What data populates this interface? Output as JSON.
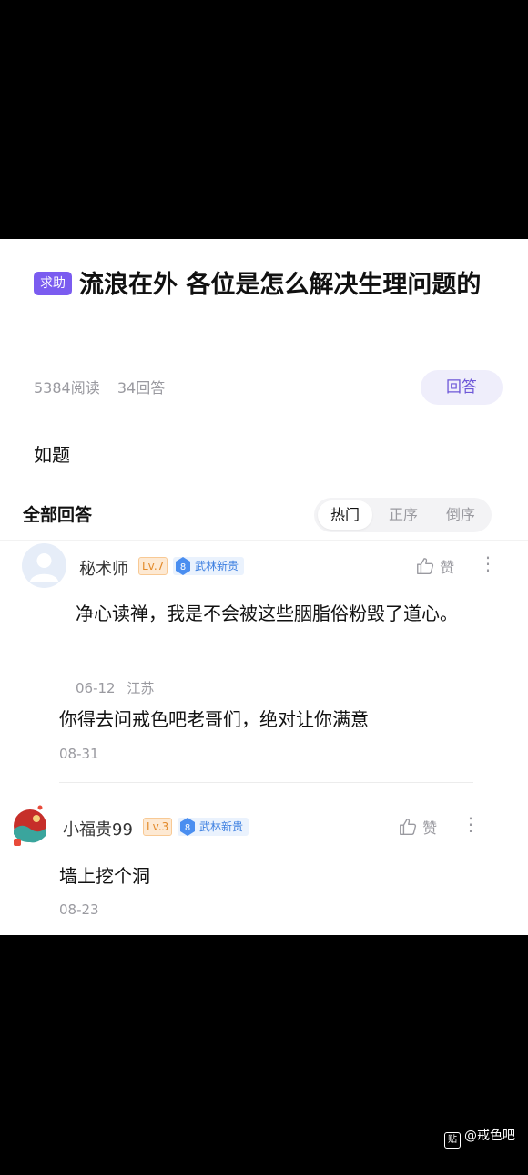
{
  "post": {
    "tag": "求助",
    "title": "流浪在外 各位是怎么解决生理问题的",
    "reads": "5384阅读",
    "answers": "34回答",
    "answer_button": "回答",
    "body": "如题"
  },
  "answers_section": {
    "title": "全部回答",
    "sort_tabs": [
      "热门",
      "正序",
      "倒序"
    ],
    "active_tab": "热门"
  },
  "comments": [
    {
      "username": "秘术师",
      "level": "Lv.7",
      "medal_num": "8",
      "medal": "武林新贵",
      "like_label": "赞",
      "text": "净心读禅，我是不会被这些胭脂俗粉毁了道心。",
      "date": "06-12",
      "location": "江苏",
      "reply": {
        "text": "你得去问戒色吧老哥们，绝对让你满意",
        "date": "08-31"
      }
    },
    {
      "username": "小福贵99",
      "level": "Lv.3",
      "medal_num": "8",
      "medal": "武林新贵",
      "like_label": "赞",
      "text": "墙上挖个洞",
      "date": "08-23"
    }
  ],
  "watermark": {
    "icon_text": "贴",
    "text": "@戒色吧"
  },
  "colors": {
    "accent": "#7b5cf0",
    "answer_btn_bg": "#efeefb",
    "level_bg": "#fde9d3",
    "medal_bg": "#eaf2fd"
  }
}
